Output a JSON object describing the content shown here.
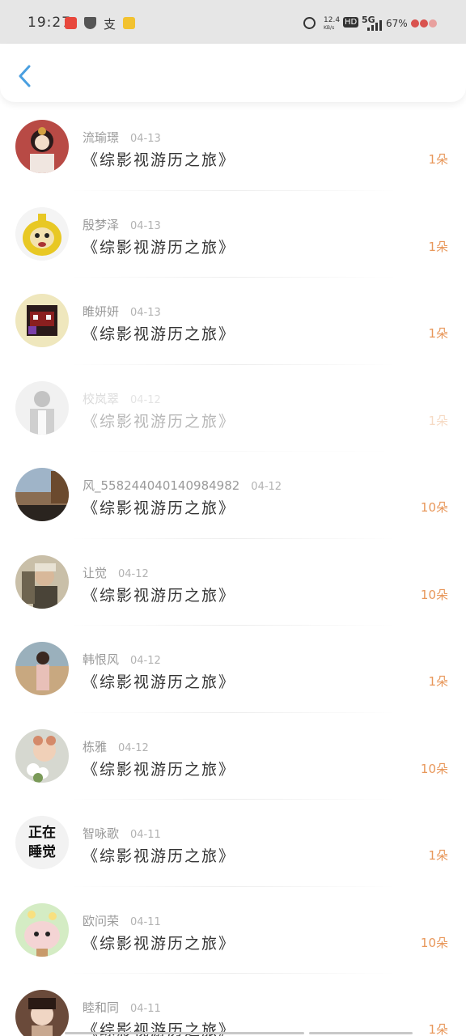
{
  "status_bar": {
    "time": "19:27",
    "net_speed_value": "12.4",
    "net_speed_unit": "KB/s",
    "hd": "HD",
    "network": "5G",
    "battery": "67%"
  },
  "list": [
    {
      "name": "流瑜璟",
      "date": "04-13",
      "title": "《综影视游历之旅》",
      "amount": "1朵",
      "avatar": "illustration-woman"
    },
    {
      "name": "殷梦泽",
      "date": "04-13",
      "title": "《综影视游历之旅》",
      "amount": "1朵",
      "avatar": "yellow-cartoon"
    },
    {
      "name": "睢妍妍",
      "date": "04-13",
      "title": "《综影视游历之旅》",
      "amount": "1朵",
      "avatar": "pixel-monster"
    },
    {
      "name": "校岚翠",
      "date": "04-12",
      "title": "《综影视游历之旅》",
      "amount": "1朵",
      "avatar": "sketch-figure"
    },
    {
      "name": "风_558244040140984982",
      "date": "04-12",
      "title": "《综影视游历之旅》",
      "amount": "10朵",
      "avatar": "landscape"
    },
    {
      "name": "让觉",
      "date": "04-12",
      "title": "《综影视游历之旅》",
      "amount": "10朵",
      "avatar": "person-cap"
    },
    {
      "name": "韩恨风",
      "date": "04-12",
      "title": "《综影视游历之旅》",
      "amount": "1朵",
      "avatar": "woman-beach"
    },
    {
      "name": "栋雅",
      "date": "04-12",
      "title": "《综影视游历之旅》",
      "amount": "10朵",
      "avatar": "child-flowers"
    },
    {
      "name": "智咏歌",
      "date": "04-11",
      "title": "《综影视游历之旅》",
      "amount": "1朵",
      "avatar_text": [
        "正在",
        "睡觉"
      ]
    },
    {
      "name": "欧问荣",
      "date": "04-11",
      "title": "《综影视游历之旅》",
      "amount": "10朵",
      "avatar": "cute-cartoon"
    },
    {
      "name": "睦和同",
      "date": "04-11",
      "title": "《综影视游历之旅》",
      "amount": "1朵",
      "avatar": "woman-portrait"
    }
  ],
  "colors": {
    "accent": "#e8975a",
    "back": "#4a9fe0",
    "name": "#9a9a9a"
  }
}
